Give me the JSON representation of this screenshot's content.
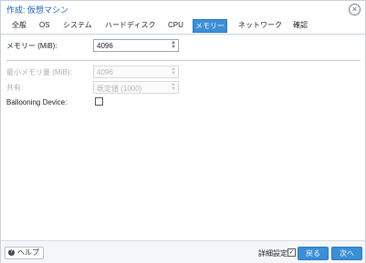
{
  "window": {
    "title": "作成: 仮想マシン",
    "close_icon": "close-icon"
  },
  "tabs": [
    {
      "label": "全般",
      "active": false
    },
    {
      "label": "OS",
      "active": false
    },
    {
      "label": "システム",
      "active": false
    },
    {
      "label": "ハードディスク",
      "active": false
    },
    {
      "label": "CPU",
      "active": false
    },
    {
      "label": "メモリー",
      "active": true
    },
    {
      "label": "ネットワーク",
      "active": false
    },
    {
      "label": "確認",
      "active": false
    }
  ],
  "form": {
    "memory": {
      "label": "メモリー (MiB):",
      "value": "4096"
    },
    "min_memory": {
      "label": "最小メモリ量 (MiB):",
      "value": "4096"
    },
    "shares": {
      "label": "共有:",
      "value": "既定値 (1000)"
    },
    "ballooning": {
      "label": "Ballooning Device:",
      "checked": false
    }
  },
  "footer": {
    "help_label": "ヘルプ",
    "advanced_label": "詳細設定",
    "advanced_checked": true,
    "back_label": "戻る",
    "next_label": "次へ"
  },
  "colors": {
    "accent": "#3a8fd6",
    "title": "#1d63b5"
  }
}
